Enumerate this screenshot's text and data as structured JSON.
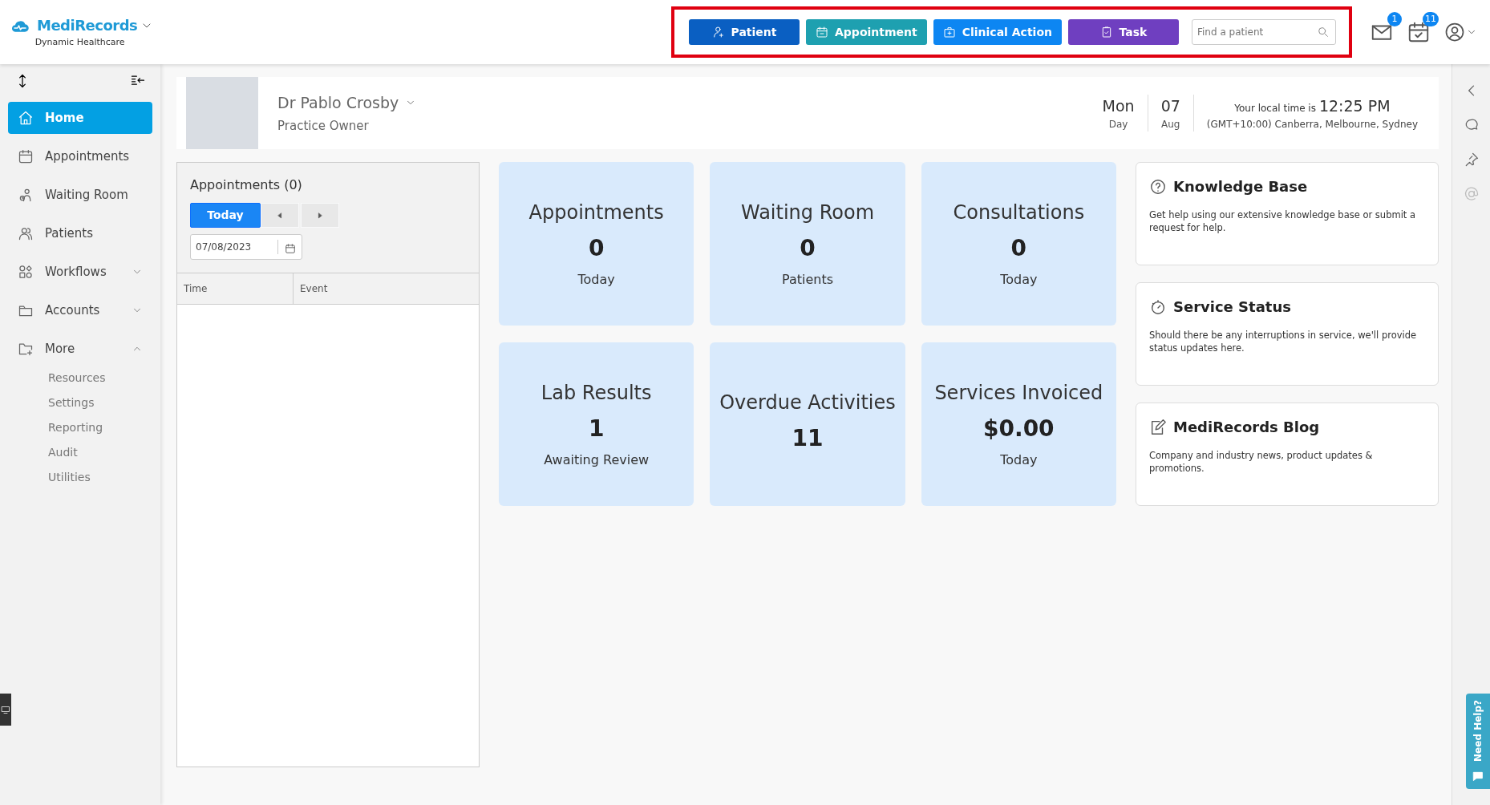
{
  "brand": {
    "name": "MediRecords",
    "tagline": "Dynamic Healthcare"
  },
  "toolbar": {
    "buttons": [
      {
        "label": "Patient",
        "kind": "patient"
      },
      {
        "label": "Appointment",
        "kind": "appointment"
      },
      {
        "label": "Clinical Action",
        "kind": "clinical"
      },
      {
        "label": "Task",
        "kind": "task"
      }
    ],
    "search": {
      "placeholder": "Find a patient"
    },
    "mail_badge": "1",
    "tasks_badge": "11"
  },
  "sidebar": {
    "items": [
      {
        "label": "Home",
        "kind": "home",
        "selected": true
      },
      {
        "label": "Appointments",
        "kind": "calendar",
        "selected": false
      },
      {
        "label": "Waiting Room",
        "kind": "waiting",
        "selected": false
      },
      {
        "label": "Patients",
        "kind": "people",
        "selected": false
      },
      {
        "label": "Workflows",
        "kind": "workflow",
        "selected": false,
        "expanded": false
      },
      {
        "label": "Accounts",
        "kind": "folder",
        "selected": false,
        "expanded": false
      },
      {
        "label": "More",
        "kind": "folder-plus",
        "selected": false,
        "expanded": true,
        "children": [
          {
            "label": "Resources",
            "selected": false
          },
          {
            "label": "Settings",
            "selected": false
          },
          {
            "label": "Reporting",
            "selected": false
          },
          {
            "label": "Audit",
            "selected": false
          },
          {
            "label": "Utilities",
            "selected": false
          }
        ]
      }
    ]
  },
  "profile": {
    "name": "Dr Pablo Crosby",
    "role": "Practice Owner"
  },
  "date": {
    "weekday": "Mon",
    "weekday_label": "Day",
    "day": "07",
    "month": "Aug"
  },
  "clock": {
    "label": "Your local time is",
    "time": "12:25 PM",
    "zone": "(GMT+10:00) Canberra, Melbourne, Sydney"
  },
  "appointments_panel": {
    "title": "Appointments (0)",
    "today_button": "Today",
    "date": "07/08/2023",
    "columns": [
      "Time",
      "Event"
    ]
  },
  "stats": [
    {
      "title": "Appointments",
      "value": "0",
      "caption": "Today"
    },
    {
      "title": "Waiting Room",
      "value": "0",
      "caption": "Patients"
    },
    {
      "title": "Consultations",
      "value": "0",
      "caption": "Today"
    },
    {
      "title": "Lab Results",
      "value": "1",
      "caption": "Awaiting Review"
    },
    {
      "title": "Overdue Activities",
      "value": "11"
    },
    {
      "title": "Services Invoiced",
      "value": "$0.00",
      "caption": "Today"
    }
  ],
  "info_cards": [
    {
      "kind": "help",
      "title": "Knowledge Base",
      "text": "Get help using our extensive knowledge base or submit a request for help."
    },
    {
      "kind": "status",
      "title": "Service Status",
      "text": "Should there be any interruptions in service, we'll provide status updates here."
    },
    {
      "kind": "blog",
      "title": "MediRecords Blog",
      "text": "Company and industry news, product updates & promotions."
    }
  ],
  "help_tab": "Need Help?"
}
